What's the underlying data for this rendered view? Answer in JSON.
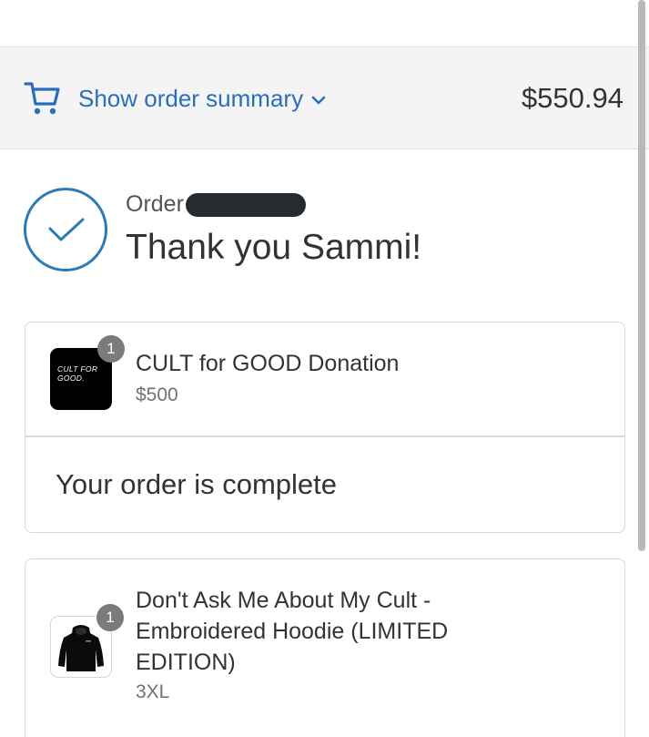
{
  "summary": {
    "toggle_label": "Show order summary",
    "total": "$550.94",
    "accent_color": "#2a6ebb"
  },
  "confirmation": {
    "order_label": "Order",
    "thank_you": "Thank you Sammi!"
  },
  "order1": {
    "item": {
      "name": "CULT for GOOD Donation",
      "price": "$500",
      "quantity": "1",
      "thumb_text": "CULT FOR GOOD."
    },
    "status": "Your order is complete"
  },
  "order2": {
    "item": {
      "name": "Don't Ask Me About My Cult - Embroidered Hoodie (LIMITED EDITION)",
      "variant": "3XL",
      "quantity": "1"
    }
  }
}
